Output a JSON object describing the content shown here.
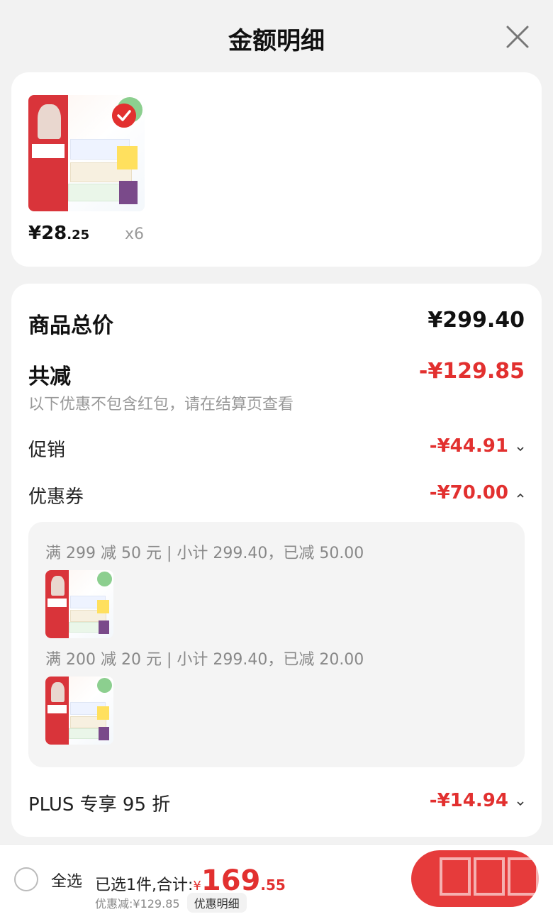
{
  "header": {
    "title": "金额明细"
  },
  "product": {
    "price_int": "¥28",
    "price_dec": ".25",
    "quantity": "x6"
  },
  "detail": {
    "total_label": "商品总价",
    "total_value": "¥299.40",
    "reduce_label": "共减",
    "reduce_value": "-¥129.85",
    "note": "以下优惠不包含红包，请在结算页查看",
    "promo_label": "促销",
    "promo_value": "-¥44.91",
    "coupon_label": "优惠券",
    "coupon_value": "-¥70.00",
    "coupons": [
      {
        "text": "满 299 减 50 元 | 小计 299.40，已减 50.00"
      },
      {
        "text": "满 200 减 20 元 | 小计 299.40，已减 20.00"
      }
    ],
    "plus_label": "PLUS 专享 95 折",
    "plus_value": "-¥14.94"
  },
  "bottom": {
    "select_all": "全选",
    "selected_prefix": "已选1件,合计:",
    "currency": "¥",
    "amount_int": "169",
    "amount_dec": ".55",
    "discount": "优惠减:¥129.85",
    "detail_link": "优惠明细"
  },
  "colors": {
    "accent": "#e2302f",
    "checkout": "#e63b3b"
  },
  "icons": [
    "close-icon",
    "check-icon",
    "chevron-down-icon",
    "chevron-up-icon"
  ]
}
